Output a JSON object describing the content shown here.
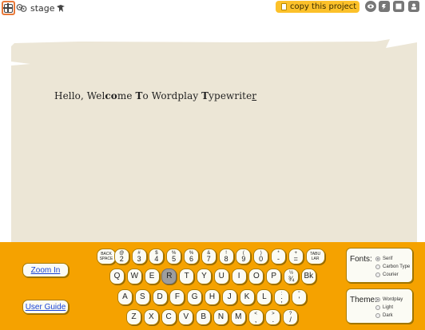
{
  "topbar": {
    "stage_label": "stage",
    "copy_label": "copy this project"
  },
  "paper": {
    "seg1": "Hello, Wel",
    "seg2": "co",
    "seg3": "me ",
    "seg4": "T",
    "seg5": "o Wordplay ",
    "seg6": "T",
    "seg7": "ypewrite",
    "seg8": "r"
  },
  "buttons": {
    "zoom_in": "Zoom In",
    "user_guide": "User Guide"
  },
  "keyboard": {
    "row1": [
      {
        "tiny": "BACK SPACE"
      },
      {
        "top": "@",
        "bot": "2"
      },
      {
        "top": "#",
        "bot": "3"
      },
      {
        "top": "$",
        "bot": "4"
      },
      {
        "top": "%",
        "bot": "5"
      },
      {
        "top": "%",
        "bot": "6"
      },
      {
        "top": "&",
        "bot": "7"
      },
      {
        "top": "!",
        "bot": "8"
      },
      {
        "top": "(",
        "bot": "9"
      },
      {
        "top": ")",
        "bot": "0"
      },
      {
        "top": "*",
        "bot": "-"
      },
      {
        "top": "+",
        "bot": "="
      },
      {
        "tiny": "TABU LAR"
      }
    ],
    "row2": [
      {
        "single": "Q"
      },
      {
        "single": "W"
      },
      {
        "single": "E"
      },
      {
        "single": "R"
      },
      {
        "single": "T"
      },
      {
        "single": "Y"
      },
      {
        "single": "U"
      },
      {
        "single": "I"
      },
      {
        "single": "O"
      },
      {
        "single": "P"
      },
      {
        "top": "½",
        "bot": "¾"
      },
      {
        "single": "Bk"
      }
    ],
    "row3": [
      {
        "single": "A"
      },
      {
        "single": "S"
      },
      {
        "single": "D"
      },
      {
        "single": "F"
      },
      {
        "single": "G"
      },
      {
        "single": "H"
      },
      {
        "single": "J"
      },
      {
        "single": "K"
      },
      {
        "single": "L"
      },
      {
        "top": ":",
        "bot": ";"
      },
      {
        "top": "\"",
        "bot": "'"
      }
    ],
    "row4": [
      {
        "single": "Z"
      },
      {
        "single": "X"
      },
      {
        "single": "C"
      },
      {
        "single": "V"
      },
      {
        "single": "B"
      },
      {
        "single": "N"
      },
      {
        "single": "M"
      },
      {
        "top": "<",
        "bot": ","
      },
      {
        "top": ">",
        "bot": "."
      },
      {
        "top": "?",
        "bot": "/"
      }
    ],
    "pressed_key": "R"
  },
  "fonts": {
    "title": "Fonts:",
    "options": [
      "Serif",
      "Carbon Type",
      "Courier"
    ],
    "selected": "Serif"
  },
  "theme": {
    "title": "Theme:",
    "options": [
      "Wordplay",
      "Light",
      "Dark"
    ],
    "selected": "Wordplay"
  },
  "colors": {
    "panel": "#f5a200",
    "paper": "#ece6d6",
    "copy_button": "#fcc12a",
    "link": "#1a44d6",
    "fullscreen_border": "#e8793a"
  },
  "icons": [
    "fullscreen-icon",
    "see-inside-icon",
    "stage-sprite-icon",
    "copy-doc-icon",
    "eye-icon",
    "turbo-icon",
    "small-stage-icon",
    "account-icon"
  ]
}
